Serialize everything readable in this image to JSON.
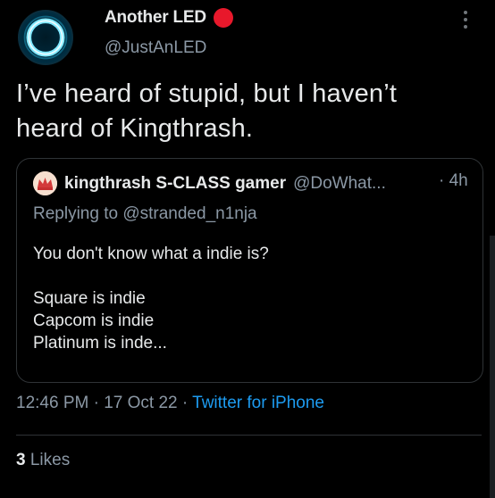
{
  "tweet": {
    "author": {
      "display_name": "Another LED",
      "handle": "@JustAnLED",
      "badge_color": "#e8182b"
    },
    "text_line1": "I’ve heard of stupid, but I haven’t",
    "text_line2": "heard of Kingthrash.",
    "quoted": {
      "display_name": "kingthrash S-CLASS gamer",
      "handle": "@DoWhat...",
      "time": "· 4h",
      "replying_to": "Replying to @stranded_n1nja",
      "lines": [
        "You don't know what a indie is?",
        "",
        "Square is indie",
        "Capcom is indie",
        "Platinum is inde..."
      ]
    },
    "timestamp": "12:46 PM · 17 Oct 22 · ",
    "source": "Twitter for iPhone",
    "likes_count": "3",
    "likes_label": "Likes"
  },
  "icons": {
    "avatar": "glowing-ring-avatar",
    "quoted_avatar": "crown-avatar",
    "more": "more-vertical-icon"
  },
  "colors": {
    "background": "#000000",
    "text": "#e7e9ea",
    "secondary": "#8b98a5",
    "link": "#1d9bf0",
    "border": "#2f3336"
  }
}
